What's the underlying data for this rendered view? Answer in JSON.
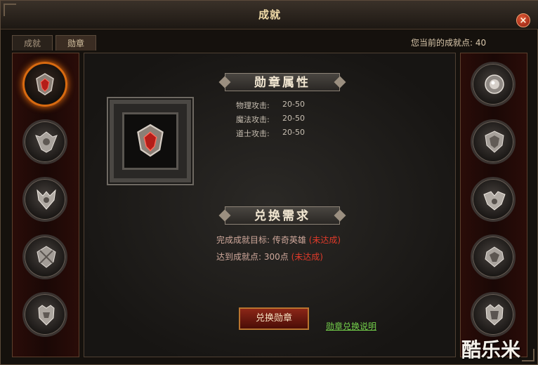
{
  "window": {
    "title": "成就",
    "close_label": "×"
  },
  "tabs": [
    {
      "label": "成就"
    },
    {
      "label": "勋章"
    }
  ],
  "points_text": "您当前的成就点: 40",
  "medal_attributes": {
    "heading": "勋章属性",
    "items": [
      {
        "label": "物理攻击:",
        "value": "20-50"
      },
      {
        "label": "魔法攻击:",
        "value": "20-50"
      },
      {
        "label": "道士攻击:",
        "value": "20-50"
      }
    ]
  },
  "exchange": {
    "heading": "兑换需求",
    "req1_label": "完成成就目标: 传奇英雄",
    "req1_status": "(未达成)",
    "req2_label": "达到成就点: 300点",
    "req2_status": "(未达成)",
    "button_label": "兑换勋章",
    "help_link": "勋章兑换说明"
  },
  "watermark": "酷乐米",
  "colors": {
    "accent_red": "#e03a2a",
    "link_green": "#74d14b",
    "selected_glow": "#d86a10"
  },
  "left_medals": [
    {
      "icon": "red-gem-medal-icon",
      "selected": true
    },
    {
      "icon": "winged-silver-medal-icon",
      "selected": false
    },
    {
      "icon": "horned-silver-medal-icon",
      "selected": false
    },
    {
      "icon": "skull-silver-medal-icon",
      "selected": false
    },
    {
      "icon": "crowned-silver-medal-icon",
      "selected": false
    }
  ],
  "right_medals": [
    {
      "icon": "orb-medal-icon"
    },
    {
      "icon": "shield-crest-medal-icon"
    },
    {
      "icon": "twin-wing-medal-icon"
    },
    {
      "icon": "eagle-medal-icon"
    },
    {
      "icon": "crowned-crest-medal-icon"
    }
  ]
}
